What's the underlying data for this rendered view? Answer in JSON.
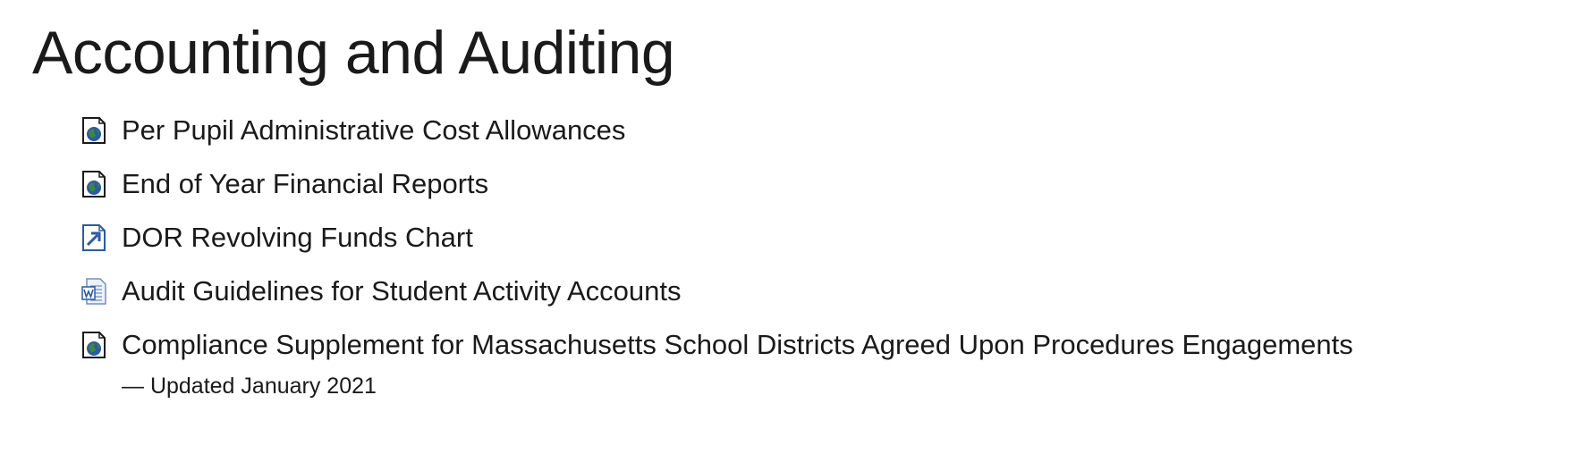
{
  "page": {
    "title": "Accounting and Auditing"
  },
  "links": [
    {
      "label": "Per Pupil Administrative Cost Allowances",
      "icon": "web-page-icon",
      "note": ""
    },
    {
      "label": "End of Year Financial Reports",
      "icon": "web-page-icon",
      "note": ""
    },
    {
      "label": "DOR Revolving Funds Chart",
      "icon": "external-link-icon",
      "note": ""
    },
    {
      "label": "Audit Guidelines for Student Activity Accounts",
      "icon": "word-document-icon",
      "note": ""
    },
    {
      "label": "Compliance Supplement for Massachusetts School Districts Agreed Upon Procedures Engagements",
      "icon": "web-page-icon",
      "note": "— Updated January 2021"
    }
  ],
  "colors": {
    "text": "#1a1a1a",
    "background": "#ffffff",
    "icon_blue": "#2a5aa8",
    "icon_green": "#3a8a3a"
  }
}
